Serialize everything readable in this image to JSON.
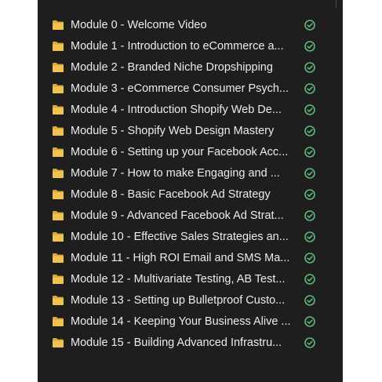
{
  "folders": [
    {
      "name": "Module 0 - Welcome Video",
      "icon": "folder-icon",
      "status": "synced-check-icon"
    },
    {
      "name": "Module 1 - Introduction to eCommerce a...",
      "icon": "folder-icon",
      "status": "synced-check-icon"
    },
    {
      "name": "Module 2 - Branded Niche Dropshipping",
      "icon": "folder-icon",
      "status": "synced-check-icon"
    },
    {
      "name": "Module 3 - eCommerce Consumer Psych...",
      "icon": "folder-icon",
      "status": "synced-check-icon"
    },
    {
      "name": "Module 4 - Introduction Shopify Web De...",
      "icon": "folder-icon",
      "status": "synced-check-icon"
    },
    {
      "name": "Module 5 - Shopify Web Design Mastery",
      "icon": "folder-icon",
      "status": "synced-check-icon"
    },
    {
      "name": "Module 6 - Setting up your Facebook Acc...",
      "icon": "folder-icon",
      "status": "synced-check-icon"
    },
    {
      "name": "Module 7 - How to make Engaging and ...",
      "icon": "folder-icon",
      "status": "synced-check-icon"
    },
    {
      "name": "Module 8 - Basic Facebook Ad Strategy",
      "icon": "folder-icon",
      "status": "synced-check-icon"
    },
    {
      "name": "Module 9 - Advanced Facebook Ad Strat...",
      "icon": "folder-icon",
      "status": "synced-check-icon"
    },
    {
      "name": "Module 10 - Effective Sales Strategies an...",
      "icon": "folder-icon",
      "status": "synced-check-icon"
    },
    {
      "name": "Module 11 - High ROI Email and SMS Ma...",
      "icon": "folder-icon",
      "status": "synced-check-icon"
    },
    {
      "name": "Module 12 - Multivariate Testing, AB Test...",
      "icon": "folder-icon",
      "status": "synced-check-icon"
    },
    {
      "name": "Module 13 - Setting up Bulletproof Custo...",
      "icon": "folder-icon",
      "status": "synced-check-icon"
    },
    {
      "name": "Module 14 - Keeping Your Business Alive ...",
      "icon": "folder-icon",
      "status": "synced-check-icon"
    },
    {
      "name": "Module 15 - Building Advanced Infrastru...",
      "icon": "folder-icon",
      "status": "synced-check-icon"
    }
  ],
  "colors": {
    "background": "#1e1e1e",
    "text": "#ececec",
    "folder": "#f0c24f",
    "folder_dark": "#d9a93a",
    "check": "#5fb878"
  }
}
